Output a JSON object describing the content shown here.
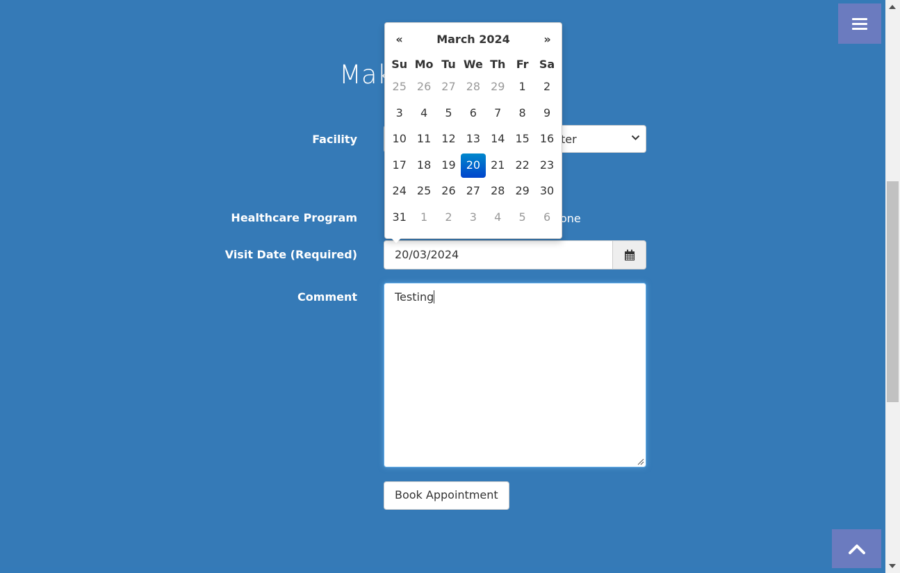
{
  "heading": "Mak",
  "form": {
    "facility_label": "Facility",
    "facility_value": "ter",
    "program_label": "Healthcare Program",
    "program_value": "one",
    "visit_date_label": "Visit Date (Required)",
    "visit_date_value": "20/03/2024",
    "comment_label": "Comment",
    "comment_value": "Testing",
    "book_button": "Book Appointment"
  },
  "datepicker": {
    "prev": "«",
    "next": "»",
    "month_year": "March 2024",
    "days_of_week": [
      "Su",
      "Mo",
      "Tu",
      "We",
      "Th",
      "Fr",
      "Sa"
    ],
    "weeks": [
      [
        {
          "d": "25",
          "cls": "old"
        },
        {
          "d": "26",
          "cls": "old"
        },
        {
          "d": "27",
          "cls": "old"
        },
        {
          "d": "28",
          "cls": "old"
        },
        {
          "d": "29",
          "cls": "old"
        },
        {
          "d": "1",
          "cls": ""
        },
        {
          "d": "2",
          "cls": ""
        }
      ],
      [
        {
          "d": "3",
          "cls": ""
        },
        {
          "d": "4",
          "cls": ""
        },
        {
          "d": "5",
          "cls": ""
        },
        {
          "d": "6",
          "cls": ""
        },
        {
          "d": "7",
          "cls": ""
        },
        {
          "d": "8",
          "cls": ""
        },
        {
          "d": "9",
          "cls": ""
        }
      ],
      [
        {
          "d": "10",
          "cls": ""
        },
        {
          "d": "11",
          "cls": ""
        },
        {
          "d": "12",
          "cls": ""
        },
        {
          "d": "13",
          "cls": ""
        },
        {
          "d": "14",
          "cls": ""
        },
        {
          "d": "15",
          "cls": ""
        },
        {
          "d": "16",
          "cls": ""
        }
      ],
      [
        {
          "d": "17",
          "cls": ""
        },
        {
          "d": "18",
          "cls": ""
        },
        {
          "d": "19",
          "cls": ""
        },
        {
          "d": "20",
          "cls": "active"
        },
        {
          "d": "21",
          "cls": ""
        },
        {
          "d": "22",
          "cls": ""
        },
        {
          "d": "23",
          "cls": ""
        }
      ],
      [
        {
          "d": "24",
          "cls": ""
        },
        {
          "d": "25",
          "cls": ""
        },
        {
          "d": "26",
          "cls": ""
        },
        {
          "d": "27",
          "cls": ""
        },
        {
          "d": "28",
          "cls": ""
        },
        {
          "d": "29",
          "cls": ""
        },
        {
          "d": "30",
          "cls": ""
        }
      ],
      [
        {
          "d": "31",
          "cls": ""
        },
        {
          "d": "1",
          "cls": "new"
        },
        {
          "d": "2",
          "cls": "new"
        },
        {
          "d": "3",
          "cls": "new"
        },
        {
          "d": "4",
          "cls": "new"
        },
        {
          "d": "5",
          "cls": "new"
        },
        {
          "d": "6",
          "cls": "new"
        }
      ]
    ]
  },
  "icons": {
    "menu": "hamburger-menu-icon",
    "scroll_top": "chevron-up-icon",
    "calendar": "calendar-icon",
    "select_chevron": "chevron-down-icon"
  },
  "colors": {
    "background": "#357ab7",
    "floating_button": "#6b7bbf",
    "active_day": "#0068cc"
  }
}
